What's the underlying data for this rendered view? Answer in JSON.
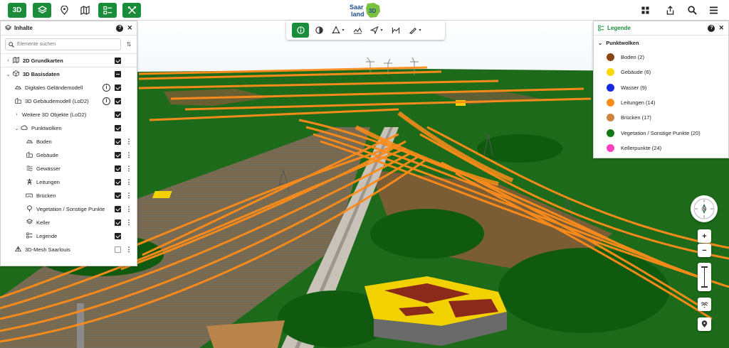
{
  "topbar": {
    "btn_3d": "3D",
    "layers_icon": "layers-icon",
    "pin_icon": "map-pin-icon",
    "map_icon": "folded-map-icon",
    "legend_icon": "legend-list-icon",
    "tools_icon": "tools-icon",
    "logo_text_top": "Saar",
    "logo_text_bottom": "land",
    "logo_badge": "3D",
    "right_icons": [
      "grid-apps-icon",
      "share-icon",
      "search-icon",
      "hamburger-menu-icon"
    ]
  },
  "contents_panel": {
    "title": "Inhalte",
    "help": "?",
    "close": "✕",
    "search_placeholder": "Elemente suchen",
    "groups": [
      {
        "label": "2D Grundkarten",
        "expanded": false,
        "state": "checked"
      },
      {
        "label": "3D Basisdaten",
        "expanded": true,
        "state": "partial"
      }
    ],
    "items": {
      "dgm": "Digitales Geländemodell",
      "lod2": "3D Gebäudemodell (LoD2)",
      "weitere": "Weitere 3D Objekte (LoD2)",
      "punktwolken": "Punktwolken",
      "boden": "Boden",
      "gebaeude": "Gebäude",
      "gewaesser": "Gewässer",
      "leitungen": "Leitungen",
      "bruecken": "Brücken",
      "vegetation": "Vegetation / Sonstige Punkte",
      "keller": "Keller",
      "legende": "Legende",
      "mesh": "3D-Mesh Saarlouis"
    }
  },
  "map_toolbar": {
    "tools": [
      "info-icon",
      "shading-icon",
      "measure-icon",
      "landscape-icon",
      "flight-icon",
      "profile-icon",
      "draw-icon"
    ],
    "active": "info-icon"
  },
  "legend_panel": {
    "title": "Legende",
    "help": "?",
    "close": "✕",
    "group": "Punktwolken",
    "items": [
      {
        "label": "Boden (2)",
        "color": "#8b4513"
      },
      {
        "label": "Gebäude (6)",
        "color": "#ffd700"
      },
      {
        "label": "Wasser (9)",
        "color": "#1428e0"
      },
      {
        "label": "Leitungen (14)",
        "color": "#ff8c1a"
      },
      {
        "label": "Brücken (17)",
        "color": "#cd853f"
      },
      {
        "label": "Vegetation / Sonstige Punkte (20)",
        "color": "#137a13"
      },
      {
        "label": "Kellerpunkte (24)",
        "color": "#ff3fc0"
      }
    ]
  },
  "map_controls": {
    "compass_label": "N",
    "zoom_in": "+",
    "zoom_out": "−"
  }
}
